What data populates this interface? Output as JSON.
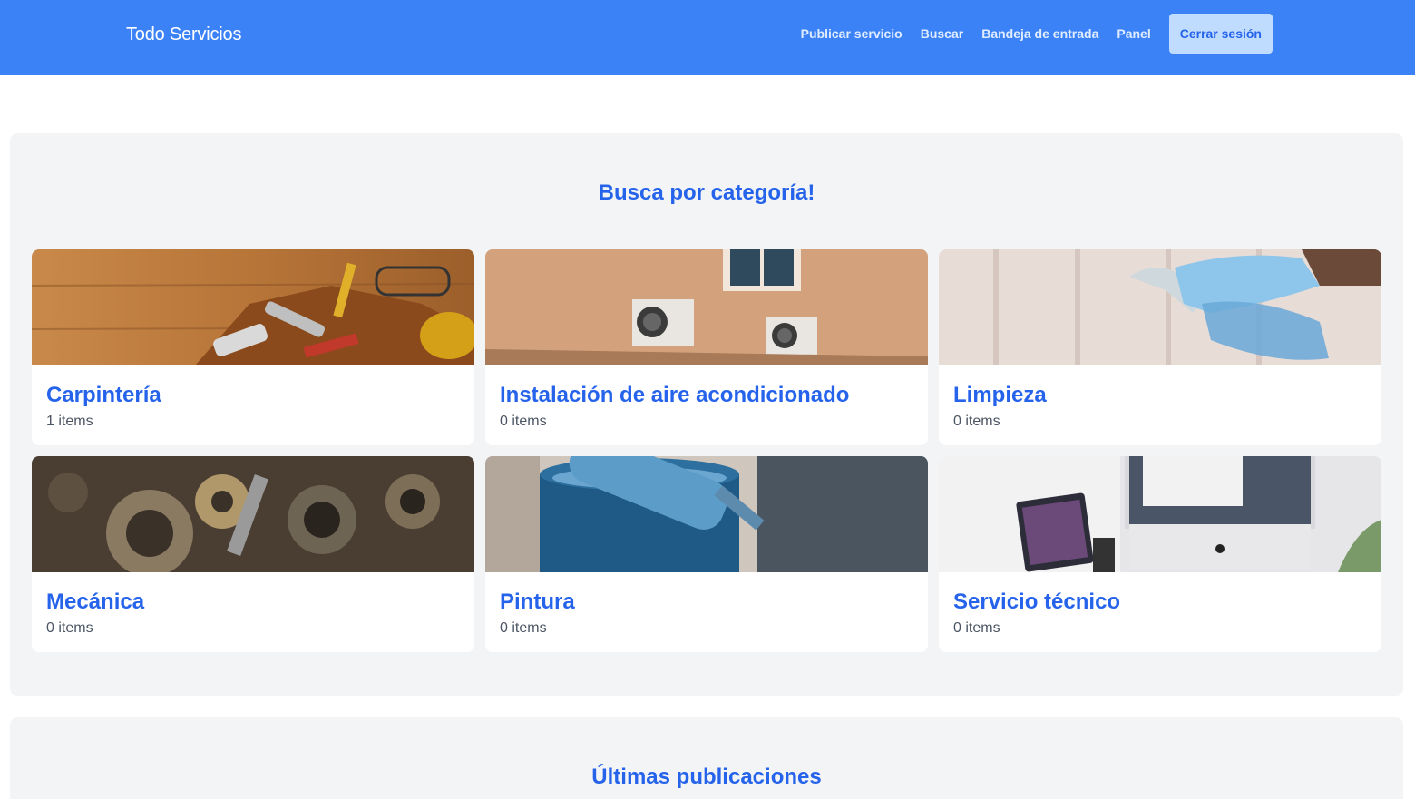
{
  "header": {
    "brand": "Todo Servicios",
    "nav": {
      "publish": "Publicar servicio",
      "search": "Buscar",
      "inbox": "Bandeja de entrada",
      "panel": "Panel",
      "logout": "Cerrar sesión"
    }
  },
  "categories_section": {
    "title": "Busca por categoría!",
    "categories": [
      {
        "name": "Carpintería",
        "count": "1 items",
        "icon": "carpentry-tools-image"
      },
      {
        "name": "Instalación de aire acondicionado",
        "count": "0 items",
        "icon": "air-conditioner-image"
      },
      {
        "name": "Limpieza",
        "count": "0 items",
        "icon": "cleaning-spray-image"
      },
      {
        "name": "Mecánica",
        "count": "0 items",
        "icon": "engine-gears-image"
      },
      {
        "name": "Pintura",
        "count": "0 items",
        "icon": "paint-roller-image"
      },
      {
        "name": "Servicio técnico",
        "count": "0 items",
        "icon": "computer-devices-image"
      }
    ]
  },
  "latest_section": {
    "title": "Últimas publicaciones"
  },
  "colors": {
    "navbar": "#3b82f6",
    "accent": "#2563eb",
    "section_bg": "#f3f4f6",
    "logout_bg": "#bfdbfe"
  }
}
